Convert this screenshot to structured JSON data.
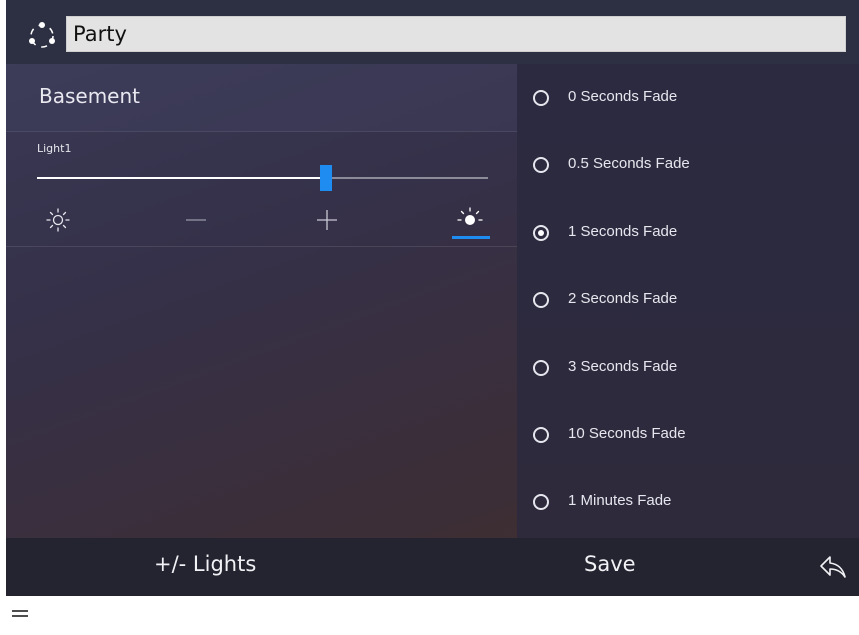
{
  "header": {
    "scene_icon": "scene-spinner-icon",
    "scene_name": "Party"
  },
  "room": {
    "title": "Basement"
  },
  "lights": [
    {
      "label": "Light1",
      "level_fraction": 0.64,
      "controls": [
        {
          "icon": "brightness-min-icon"
        },
        {
          "icon": "minus-icon"
        },
        {
          "icon": "plus-icon"
        },
        {
          "icon": "brightness-max-icon",
          "selected": true
        }
      ]
    }
  ],
  "fade_options": [
    {
      "label": "0 Seconds Fade",
      "selected": false
    },
    {
      "label": "0.5 Seconds Fade",
      "selected": false
    },
    {
      "label": "1 Seconds Fade",
      "selected": true
    },
    {
      "label": "2 Seconds Fade",
      "selected": false
    },
    {
      "label": "3 Seconds Fade",
      "selected": false
    },
    {
      "label": "10 Seconds Fade",
      "selected": false
    },
    {
      "label": "1 Minutes Fade",
      "selected": false
    }
  ],
  "footer": {
    "lights_button": "+/- Lights",
    "save_button": "Save",
    "back_icon": "back-arrow-icon"
  },
  "menu_icon": "menu-icon",
  "colors": {
    "accent": "#1e8cf0",
    "header_bg": "#2d3043",
    "footer_bg": "#23242f",
    "scene_field_bg": "#e3e3e3"
  }
}
